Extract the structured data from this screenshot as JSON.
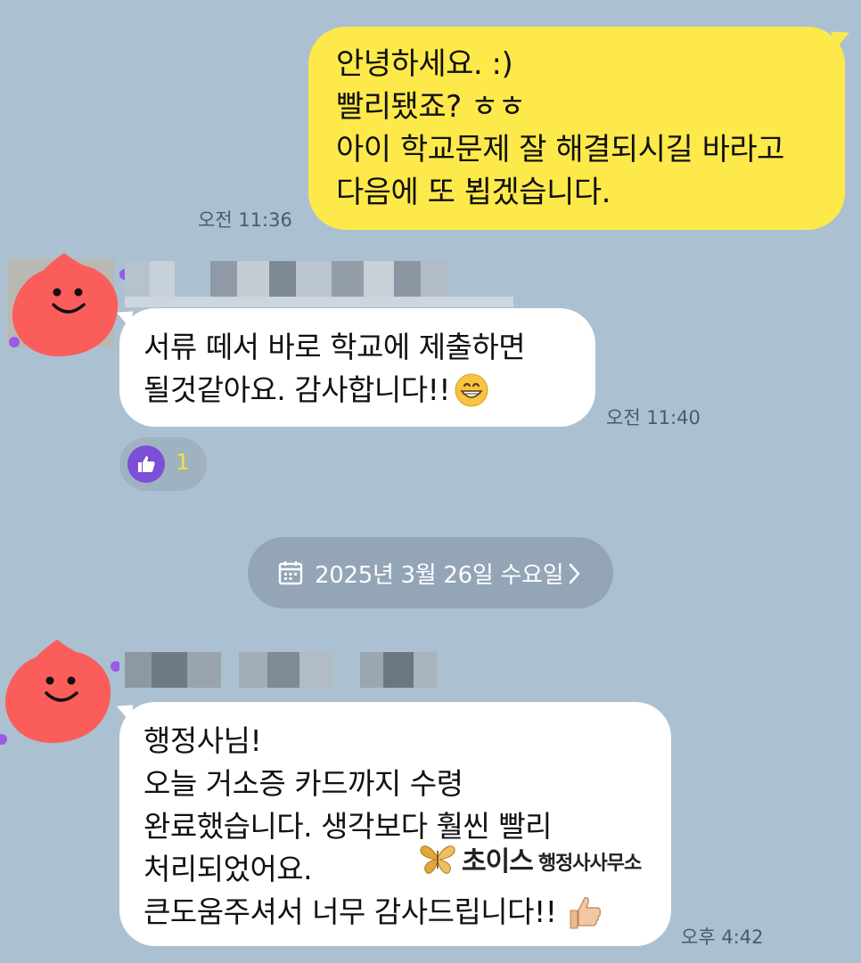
{
  "messages_out": [
    {
      "lines": [
        "안녕하세요. :)",
        "빨리됐죠? ㅎㅎ",
        "아이 학교문제 잘 해결되시길 바라고",
        "다음에 또 뵙겠습니다."
      ],
      "time": "오전 11:36"
    }
  ],
  "messages_in": [
    {
      "lines": [
        "서류 떼서 바로 학교에 제출하면",
        "될것같아요. 감사합니다!!"
      ],
      "emoji": "grinning-face",
      "time": "오전 11:40",
      "reaction": {
        "icon": "thumbs-up-icon",
        "count": "1"
      }
    },
    {
      "lines": [
        "행정사님!",
        "오늘 거소증 카드까지 수령",
        "완료했습니다. 생각보다 훨씬 빨리",
        "처리되었어요.",
        "큰도움주셔서 너무 감사드립니다!!"
      ],
      "emoji": "thumbs-up",
      "time": "오후 4:42"
    }
  ],
  "date_divider": {
    "icon": "calendar-icon",
    "label": "2025년 3월 26일 수요일",
    "chevron": "chevron-right-icon"
  },
  "watermark": {
    "logo": "butterfly-logo",
    "brand": "초이스",
    "office": "행정사사무소"
  },
  "colors": {
    "background": "#abc1d1",
    "outgoing_bubble": "#fee94b",
    "incoming_bubble": "#ffffff",
    "avatar": "#fb5d5a",
    "reaction_icon": "#7b4fd6",
    "reaction_count": "#f2e13a",
    "date_chip": "#93a5b6"
  }
}
